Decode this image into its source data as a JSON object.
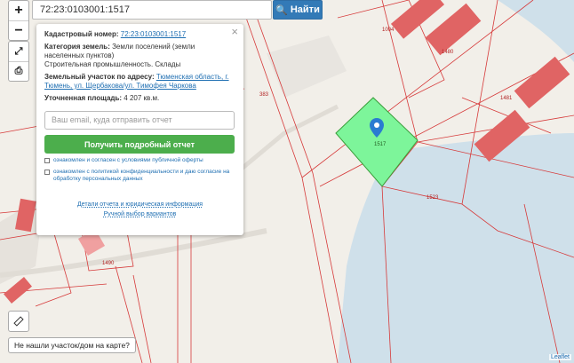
{
  "search": {
    "value": "72:23:0103001:1517",
    "button_label": "Найти",
    "button_icon": "search-icon"
  },
  "controls": {
    "zoom_in": "+",
    "zoom_out": "−",
    "fullscreen_icon": "expand-icon",
    "print_icon": "printer-icon",
    "ruler_icon": "ruler-icon"
  },
  "popup": {
    "cadastral_label": "Кадастровый номер:",
    "cadastral_value": "72:23:0103001:1517",
    "category_label": "Категория земель:",
    "category_value": "Земли поселений (земли населенных пунктов)",
    "usage_value": "Строительная промышленность. Склады",
    "address_label": "Земельный участок по адресу:",
    "address_value": "Тюменская область, г. Тюмень, ул. Щербакова/ул. Тимофея Чаркова",
    "area_label": "Уточненная площадь:",
    "area_value": "4 207 кв.м.",
    "email_placeholder": "Ваш email, куда отправить отчет",
    "report_button": "Получить подробный отчет",
    "agree1": "ознакомлен и согласен с условиями публичной оферты",
    "agree2": "ознакомлен с политикой конфиденциальности и даю согласие на обработку персональных данных",
    "link1": "Детали отчета и юридическая информация",
    "link2": "Ручной выбор вариантов"
  },
  "map": {
    "parcel_labels": [
      "1004",
      "1480",
      "383",
      "1481",
      "1523",
      "1517",
      "1490"
    ],
    "selected_parcel": "1517",
    "colors": {
      "selected": "#7df59a",
      "boundary": "#d63a3a",
      "building": "#e06464",
      "water": "#cfe0ea"
    }
  },
  "not_found": "Не нашли участок/дом на карте?",
  "attribution": "Leaflet"
}
